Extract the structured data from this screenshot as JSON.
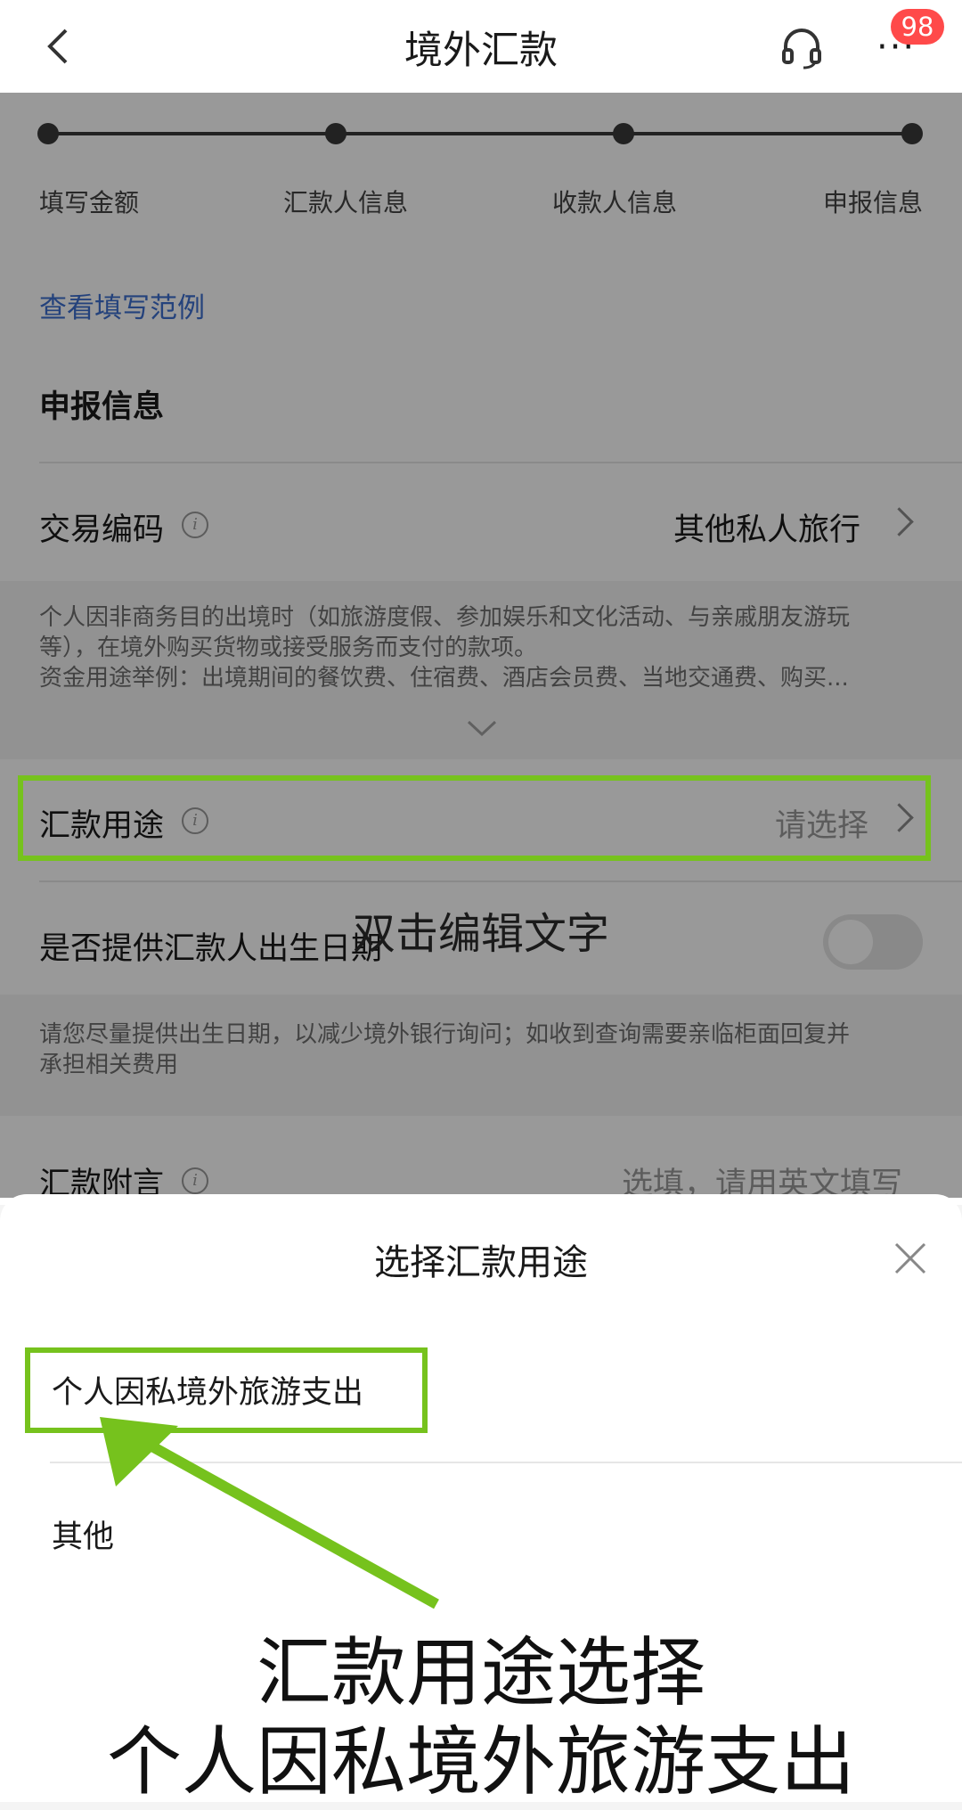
{
  "header": {
    "title": "境外汇款",
    "badge": "98",
    "more_glyph": "···"
  },
  "steps": [
    "填写金额",
    "汇款人信息",
    "收款人信息",
    "申报信息"
  ],
  "example_link": "查看填写范例",
  "section_title": "申报信息",
  "transaction_code": {
    "label": "交易编码",
    "value": "其他私人旅行"
  },
  "description": {
    "line1": "个人因非商务目的出境时（如旅游度假、参加娱乐和文化活动、与亲戚朋友游玩",
    "line2": "等），在境外购买货物或接受服务而支付的款项。",
    "line3": "资金用途举例：出境期间的餐饮费、住宿费、酒店会员费、当地交通费、购买..."
  },
  "purpose": {
    "label": "汇款用途",
    "value": "请选择"
  },
  "birthdate": {
    "label": "是否提供汇款人出生日期",
    "toggle_on": false
  },
  "birthdate_note": {
    "line1": "请您尽量提供出生日期，以减少境外银行询问；如收到查询需要亲临柜面回复并",
    "line2": "承担相关费用"
  },
  "remark": {
    "label": "汇款附言",
    "placeholder": "选填，请用英文填写"
  },
  "edit_hint": "双击编辑文字",
  "sheet": {
    "title": "选择汇款用途",
    "options": [
      "个人因私境外旅游支出",
      "其他"
    ]
  },
  "caption": {
    "line1": "汇款用途选择",
    "line2": "个人因私境外旅游支出"
  },
  "colors": {
    "highlight": "#76c21d",
    "link": "#3d6fcf",
    "badge": "#ff4a4a"
  }
}
